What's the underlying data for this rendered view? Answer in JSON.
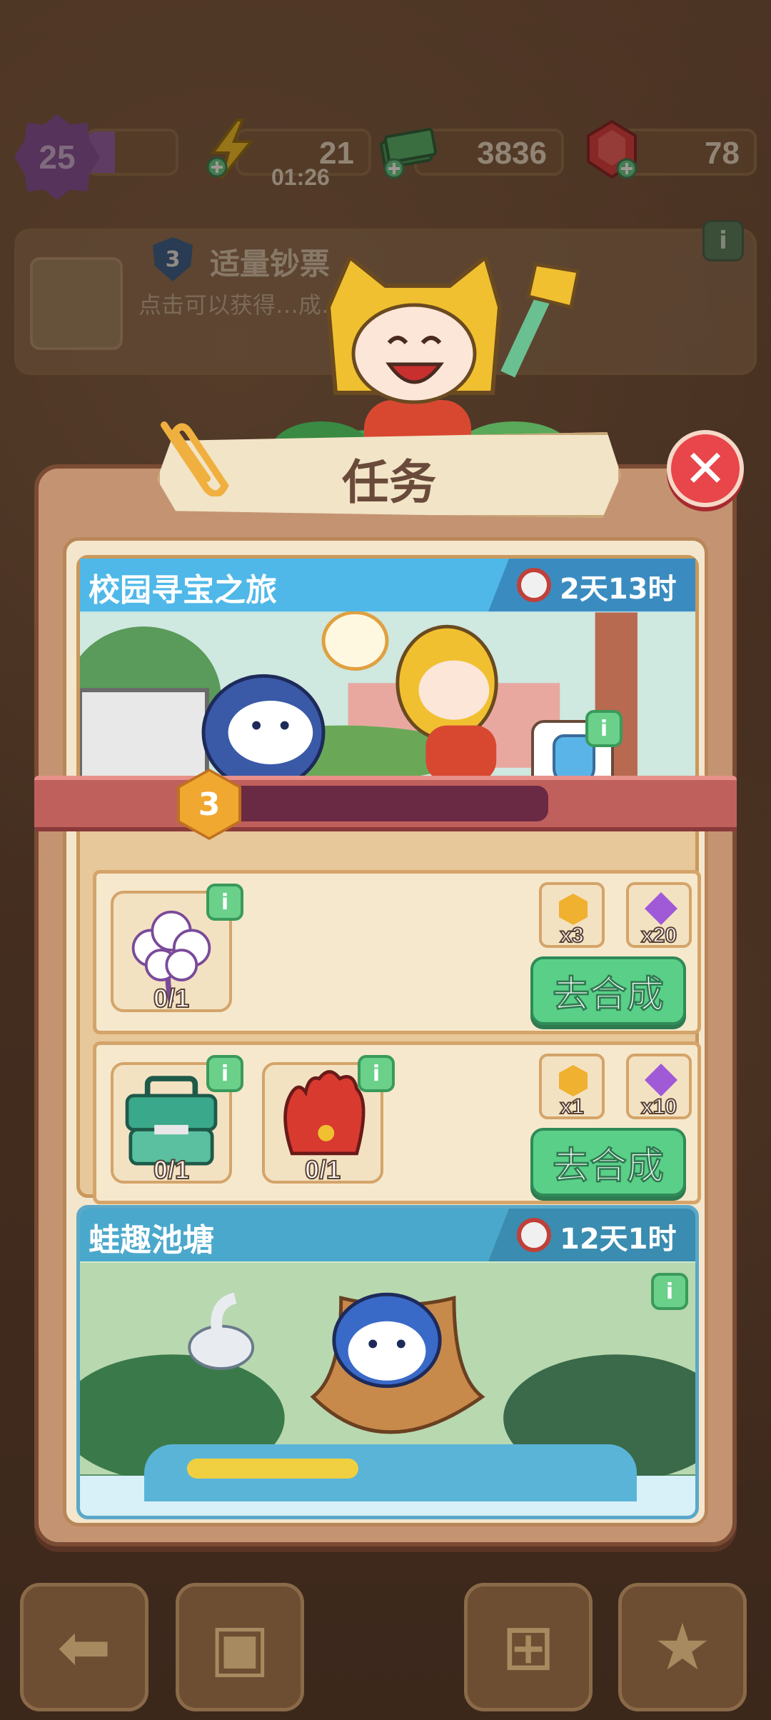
{
  "top_bar": {
    "level": "25",
    "level_progress": 0.3,
    "energy": "21",
    "energy_timer": "01:26",
    "cash": "3836",
    "gems": "78"
  },
  "background_order": {
    "rank": "3",
    "title": "适量钞票",
    "description": "点击可以获得…成…务。"
  },
  "panel": {
    "title": "任务",
    "close_icon": "close-icon"
  },
  "event1": {
    "name": "校园寻宝之旅",
    "time_left": "2天13时",
    "reward_count": "x1",
    "stage": "3",
    "progress": 0,
    "tasks": [
      {
        "items": [
          {
            "icon": "cotton-flower-icon",
            "count": "0/1"
          }
        ],
        "rewards": [
          {
            "type": "coin",
            "label": "x3"
          },
          {
            "type": "gem",
            "label": "x20"
          }
        ],
        "button": "去合成"
      },
      {
        "items": [
          {
            "icon": "toolbox-icon",
            "count": "0/1"
          },
          {
            "icon": "baseball-glove-icon",
            "count": "0/1"
          }
        ],
        "rewards": [
          {
            "type": "coin",
            "label": "x1"
          },
          {
            "type": "gem",
            "label": "x10"
          }
        ],
        "button": "去合成"
      }
    ]
  },
  "event2": {
    "name": "蛙趣池塘",
    "time_left": "12天1时"
  },
  "bottom_nav": [
    "back-icon",
    "backpack-icon",
    "basket-icon",
    "task-card-icon"
  ]
}
